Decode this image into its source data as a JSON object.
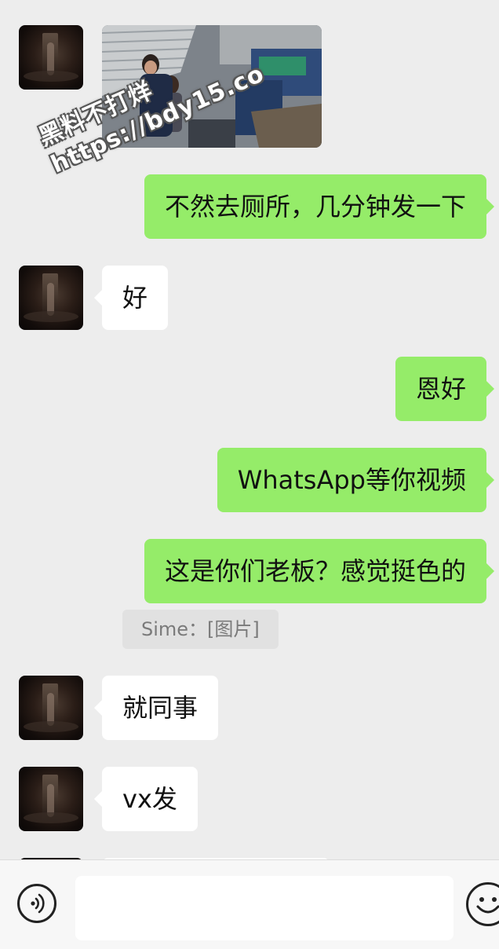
{
  "chat": {
    "messages": [
      {
        "side": "in",
        "type": "image"
      },
      {
        "side": "out",
        "text": "不然去厕所，几分钟发一下"
      },
      {
        "side": "in",
        "text": "好"
      },
      {
        "side": "out",
        "text": "恩好"
      },
      {
        "side": "out",
        "text": "WhatsApp等你视频"
      },
      {
        "side": "out",
        "text": "这是你们老板？感觉挺色的"
      },
      {
        "side": "in",
        "text": "就同事"
      },
      {
        "side": "in",
        "text": "vx发"
      }
    ],
    "quote": "Sime：[图片]"
  },
  "watermark": {
    "line1": "黑料不打烊",
    "line2": "https://bdy15.co"
  },
  "input_bar": {
    "placeholder": "",
    "voice_icon": "voice-icon",
    "emoji_icon": "emoji-icon"
  },
  "colors": {
    "background": "#ededed",
    "outgoing_bubble": "#95ec69",
    "incoming_bubble": "#ffffff"
  }
}
